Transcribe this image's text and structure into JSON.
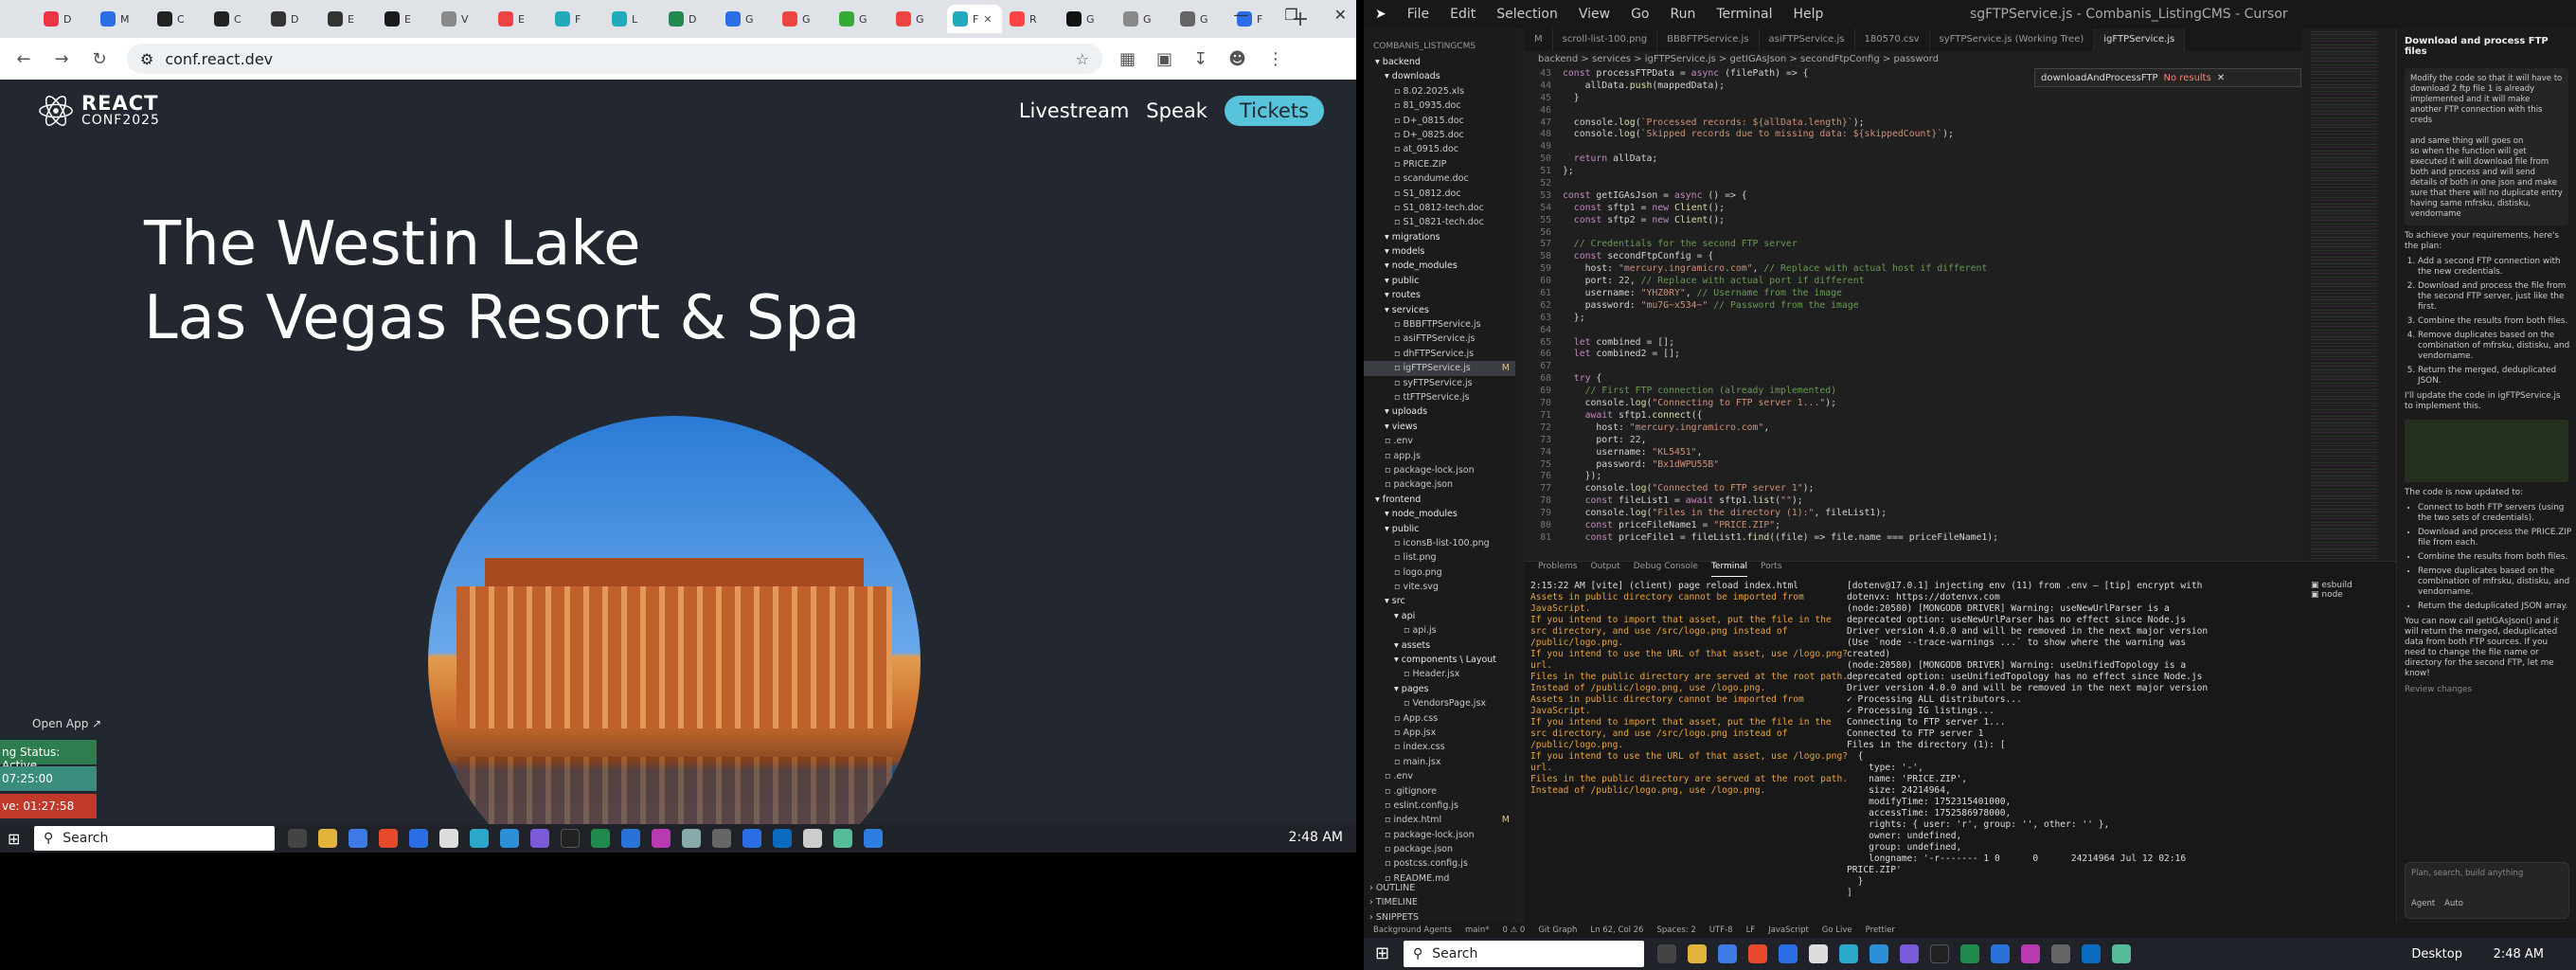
{
  "browser": {
    "tabs": [
      "D",
      "M",
      "C",
      "C",
      "D",
      "E",
      "E",
      "V",
      "E",
      "F",
      "L",
      "D",
      "G",
      "G",
      "G",
      "G",
      "F",
      "R",
      "G",
      "G",
      "G",
      "F"
    ],
    "url": "conf.react.dev",
    "new_tab": "+"
  },
  "site": {
    "logo_line1": "REACT",
    "logo_line2": "CONF2025",
    "nav": {
      "livestream": "Livestream",
      "speak": "Speak",
      "tickets": "Tickets"
    },
    "venue_line1": "The Westin Lake",
    "venue_line2": "Las Vegas Resort & Spa",
    "open_app": "Open App ↗",
    "status_active": "ng Status: Active",
    "timer1": "07:25:00",
    "timer2": "ve: 01:27:58"
  },
  "taskbar_left": {
    "search": "Search",
    "time": "2:48 AM"
  },
  "cursor": {
    "menu": [
      "File",
      "Edit",
      "Selection",
      "View",
      "Go",
      "Run",
      "Terminal",
      "Help"
    ],
    "window_title": "sgFTPService.js - Combanis_ListingCMS - Cursor",
    "explorer_head": "COMBANIS_LISTINGCMS",
    "explorer": [
      {
        "n": "backend",
        "d": 0,
        "f": true
      },
      {
        "n": "downloads",
        "d": 1,
        "f": true
      },
      {
        "n": "8.02.2025.xls",
        "d": 2,
        "f": false
      },
      {
        "n": "81_0935.doc",
        "d": 2,
        "f": false
      },
      {
        "n": "D+_0815.doc",
        "d": 2,
        "f": false
      },
      {
        "n": "D+_0825.doc",
        "d": 2,
        "f": false
      },
      {
        "n": "at_0915.doc",
        "d": 2,
        "f": false
      },
      {
        "n": "PRICE.ZIP",
        "d": 2,
        "f": false
      },
      {
        "n": "scandume.doc",
        "d": 2,
        "f": false
      },
      {
        "n": "S1_0812.doc",
        "d": 2,
        "f": false
      },
      {
        "n": "S1_0812-tech.doc",
        "d": 2,
        "f": false
      },
      {
        "n": "S1_0821-tech.doc",
        "d": 2,
        "f": false
      },
      {
        "n": "migrations",
        "d": 1,
        "f": true
      },
      {
        "n": "models",
        "d": 1,
        "f": true
      },
      {
        "n": "node_modules",
        "d": 1,
        "f": true
      },
      {
        "n": "public",
        "d": 1,
        "f": true
      },
      {
        "n": "routes",
        "d": 1,
        "f": true
      },
      {
        "n": "services",
        "d": 1,
        "f": true
      },
      {
        "n": "BBBFTPService.js",
        "d": 2,
        "f": false
      },
      {
        "n": "asiFTPService.js",
        "d": 2,
        "f": false
      },
      {
        "n": "dhFTPService.js",
        "d": 2,
        "f": false
      },
      {
        "n": "igFTPService.js",
        "d": 2,
        "f": false,
        "sel": true,
        "badge": "M"
      },
      {
        "n": "syFTPService.js",
        "d": 2,
        "f": false
      },
      {
        "n": "ttFTPService.js",
        "d": 2,
        "f": false
      },
      {
        "n": "uploads",
        "d": 1,
        "f": true
      },
      {
        "n": "views",
        "d": 1,
        "f": true
      },
      {
        "n": ".env",
        "d": 1,
        "f": false
      },
      {
        "n": "app.js",
        "d": 1,
        "f": false
      },
      {
        "n": "package-lock.json",
        "d": 1,
        "f": false
      },
      {
        "n": "package.json",
        "d": 1,
        "f": false
      },
      {
        "n": "frontend",
        "d": 0,
        "f": true
      },
      {
        "n": "node_modules",
        "d": 1,
        "f": true
      },
      {
        "n": "public",
        "d": 1,
        "f": true
      },
      {
        "n": "iconsB-list-100.png",
        "d": 2,
        "f": false
      },
      {
        "n": "list.png",
        "d": 2,
        "f": false
      },
      {
        "n": "logo.png",
        "d": 2,
        "f": false
      },
      {
        "n": "vite.svg",
        "d": 2,
        "f": false
      },
      {
        "n": "src",
        "d": 1,
        "f": true
      },
      {
        "n": "api",
        "d": 2,
        "f": true
      },
      {
        "n": "api.js",
        "d": 3,
        "f": false
      },
      {
        "n": "assets",
        "d": 2,
        "f": true
      },
      {
        "n": "components \\ Layout",
        "d": 2,
        "f": true
      },
      {
        "n": "Header.jsx",
        "d": 3,
        "f": false
      },
      {
        "n": "pages",
        "d": 2,
        "f": true
      },
      {
        "n": "VendorsPage.jsx",
        "d": 3,
        "f": false
      },
      {
        "n": "App.css",
        "d": 2,
        "f": false
      },
      {
        "n": "App.jsx",
        "d": 2,
        "f": false
      },
      {
        "n": "index.css",
        "d": 2,
        "f": false
      },
      {
        "n": "main.jsx",
        "d": 2,
        "f": false
      },
      {
        "n": ".env",
        "d": 1,
        "f": false
      },
      {
        "n": ".gitignore",
        "d": 1,
        "f": false
      },
      {
        "n": "eslint.config.js",
        "d": 1,
        "f": false
      },
      {
        "n": "index.html",
        "d": 1,
        "f": false,
        "badge": "M"
      },
      {
        "n": "package-lock.json",
        "d": 1,
        "f": false
      },
      {
        "n": "package.json",
        "d": 1,
        "f": false
      },
      {
        "n": "postcss.config.js",
        "d": 1,
        "f": false
      },
      {
        "n": "README.md",
        "d": 1,
        "f": false
      }
    ],
    "explorer_footer": [
      "OUTLINE",
      "TIMELINE",
      "SNIPPETS"
    ],
    "editor_tabs": [
      "M",
      "scroll-list-100.png",
      "BBBFTPService.js",
      "asiFTPService.js",
      "180570.csv",
      "syFTPService.js (Working Tree)",
      "igFTPService.js"
    ],
    "breadcrumb": "backend > services > igFTPService.js > getIGAsJson > secondFtpConfig > password",
    "find_text": "downloadAndProcessFTP",
    "find_result": "No results",
    "code": [
      {
        "n": "43",
        "t": "const processFTPData = async (filePath) => {"
      },
      {
        "n": "44",
        "t": "    allData.push(mappedData);"
      },
      {
        "n": "45",
        "t": "  }"
      },
      {
        "n": "46",
        "t": ""
      },
      {
        "n": "47",
        "t": "  console.log(`Processed records: ${allData.length}`);"
      },
      {
        "n": "48",
        "t": "  console.log(`Skipped records due to missing data: ${skippedCount}`);"
      },
      {
        "n": "49",
        "t": ""
      },
      {
        "n": "50",
        "t": "  return allData;"
      },
      {
        "n": "51",
        "t": "};"
      },
      {
        "n": "52",
        "t": ""
      },
      {
        "n": "53",
        "t": "const getIGAsJson = async () => {"
      },
      {
        "n": "54",
        "t": "  const sftp1 = new Client();"
      },
      {
        "n": "55",
        "t": "  const sftp2 = new Client();"
      },
      {
        "n": "56",
        "t": ""
      },
      {
        "n": "57",
        "t": "  // Credentials for the second FTP server"
      },
      {
        "n": "58",
        "t": "  const secondFtpConfig = {"
      },
      {
        "n": "59",
        "t": "    host: \"mercury.ingramicro.com\", // Replace with actual host if different"
      },
      {
        "n": "60",
        "t": "    port: 22, // Replace with actual port if different"
      },
      {
        "n": "61",
        "t": "    username: \"YHZ0RY\", // Username from the image"
      },
      {
        "n": "62",
        "t": "    password: \"mu7G~x534~\" // Password from the image"
      },
      {
        "n": "63",
        "t": "  };"
      },
      {
        "n": "64",
        "t": ""
      },
      {
        "n": "65",
        "t": "  let combined = [];"
      },
      {
        "n": "66",
        "t": "  let combined2 = [];"
      },
      {
        "n": "67",
        "t": ""
      },
      {
        "n": "68",
        "t": "  try {"
      },
      {
        "n": "69",
        "t": "    // First FTP connection (already implemented)"
      },
      {
        "n": "70",
        "t": "    console.log(\"Connecting to FTP server 1...\");"
      },
      {
        "n": "71",
        "t": "    await sftp1.connect({"
      },
      {
        "n": "72",
        "t": "      host: \"mercury.ingramicro.com\","
      },
      {
        "n": "73",
        "t": "      port: 22,"
      },
      {
        "n": "74",
        "t": "      username: \"KL5451\","
      },
      {
        "n": "75",
        "t": "      password: \"Bx1dWPU55B\""
      },
      {
        "n": "76",
        "t": "    });"
      },
      {
        "n": "77",
        "t": "    console.log(\"Connected to FTP server 1\");"
      },
      {
        "n": "78",
        "t": "    const fileList1 = await sftp1.list(\"\");"
      },
      {
        "n": "79",
        "t": "    console.log(\"Files in the directory (1):\", fileList1);"
      },
      {
        "n": "80",
        "t": "    const priceFileName1 = \"PRICE.ZIP\";"
      },
      {
        "n": "81",
        "t": "    const priceFile1 = fileList1.find((file) => file.name === priceFileName1);"
      }
    ],
    "panel_tabs": [
      "Problems",
      "Output",
      "Debug Console",
      "Terminal",
      "Ports"
    ],
    "term1": [
      {
        "t": "2:15:22 AM [vite] (client) page reload index.html",
        "w": true
      },
      {
        "t": "Assets in public directory cannot be imported from JavaScript.",
        "w": false
      },
      {
        "t": "If you intend to import that asset, put the file in the src directory, and use /src/logo.png instead of /public/logo.png.",
        "w": false
      },
      {
        "t": "If you intend to use the URL of that asset, use /logo.png?url.",
        "w": false
      },
      {
        "t": "Files in the public directory are served at the root path.",
        "w": false
      },
      {
        "t": "Instead of /public/logo.png, use /logo.png.",
        "w": false
      },
      {
        "t": "Assets in public directory cannot be imported from JavaScript.",
        "w": false
      },
      {
        "t": "If you intend to import that asset, put the file in the src directory, and use /src/logo.png instead of /public/logo.png.",
        "w": false
      },
      {
        "t": "If you intend to use the URL of that asset, use /logo.png?url.",
        "w": false
      },
      {
        "t": "Files in the public directory are served at the root path.",
        "w": false
      },
      {
        "t": "Instead of /public/logo.png, use /logo.png.",
        "w": false
      }
    ],
    "term2": [
      "[dotenv@17.0.1] injecting env (11) from .env – [tip] encrypt with dotenvx: https://dotenvx.com",
      "(node:20580) [MONGODB DRIVER] Warning: useNewUrlParser is a deprecated option: useNewUrlParser has no effect since Node.js Driver version 4.0.0 and will be removed in the next major version",
      "(Use `node --trace-warnings ...` to show where the warning was created)",
      "(node:20580) [MONGODB DRIVER] Warning: useUnifiedTopology is a deprecated option: useUnifiedTopology has no effect since Node.js Driver version 4.0.0 and will be removed in the next major version",
      "✓ Processing ALL distributors...",
      "✓ Processing IG listings...",
      "Connecting to FTP server 1...",
      "Connected to FTP server 1",
      "Files in the directory (1): [",
      "  {",
      "    type: '-',",
      "    name: 'PRICE.ZIP',",
      "    size: 24214964,",
      "    modifyTime: 1752315401000,",
      "    accessTime: 1752586978000,",
      "    rights: { user: 'r', group: '', other: '' },",
      "    owner: undefined,",
      "    group: undefined,",
      "    longname: '-r------- 1 0      0      24214964 Jul 12 02:16 PRICE.ZIP'",
      "  }",
      "]"
    ],
    "term_list": [
      "esbuild",
      "node"
    ],
    "chat": {
      "title": "Download and process FTP files",
      "question": "Modify the code so that it will have to download 2 ftp file 1 is already implemented and it will make another FTP connection with this creds\n\nand same thing will goes on\nso when the function will get executed it will download file from both and process and will send details of both in one json and make sure that there will no duplicate entry having same mfrsku, distisku, vendorname",
      "answer_intro": "To achieve your requirements, here's the plan:",
      "steps": [
        "Add a second FTP connection with the new credentials.",
        "Download and process the file from the second FTP server, just like the first.",
        "Combine the results from both files.",
        "Remove duplicates based on the combination of mfrsku, distisku, and vendorname.",
        "Return the merged, deduplicated JSON."
      ],
      "update_note": "I'll update the code in igFTPService.js to implement this.",
      "updated_head": "The code is now updated to:",
      "updated": [
        "Connect to both FTP servers (using the two sets of credentials).",
        "Download and process the PRICE.ZIP file from each.",
        "Combine the results from both files.",
        "Remove duplicates based on the combination of mfrsku, distisku, and vendorname.",
        "Return the deduplicated JSON array."
      ],
      "final": "You can now call getIGAsJson() and it will return the merged, deduplicated data from both FTP sources. If you need to change the file name or directory for the second FTP, let me know!",
      "review": "Review changes",
      "input_placeholder": "Plan, search, build anything",
      "agent": "Agent",
      "auto": "Auto"
    },
    "statusbar": [
      "Background Agents",
      "main*",
      "0 ⚠ 0",
      "Git Graph",
      "Ln 62, Col 26",
      "Spaces: 2",
      "UTF-8",
      "LF",
      "JavaScript",
      "Go Live",
      "Prettier"
    ]
  },
  "taskbar_right": {
    "search": "Search",
    "desktop": "Desktop",
    "time": "2:48 AM"
  }
}
